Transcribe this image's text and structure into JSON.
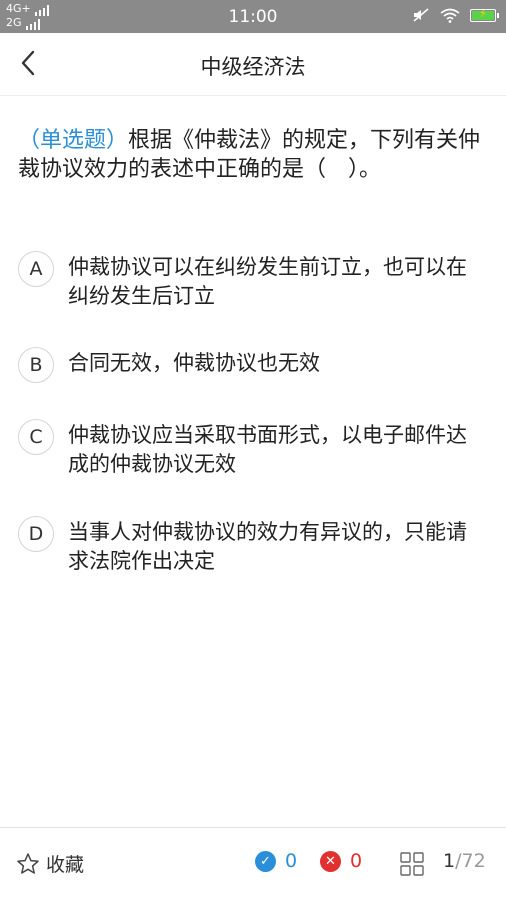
{
  "status_bar": {
    "network_primary": "4G+",
    "network_secondary": "2G",
    "time": "11:00"
  },
  "header": {
    "title": "中级经济法"
  },
  "question": {
    "type_label": "（单选题）",
    "text": "根据《仲裁法》的规定，下列有关仲裁协议效力的表述中正确的是（　）。",
    "options": [
      {
        "letter": "A",
        "text": "仲裁协议可以在纠纷发生前订立，也可以在纠纷发生后订立"
      },
      {
        "letter": "B",
        "text": "合同无效，仲裁协议也无效"
      },
      {
        "letter": "C",
        "text": "仲裁协议应当采取书面形式，以电子邮件达成的仲裁协议无效"
      },
      {
        "letter": "D",
        "text": "当事人对仲裁协议的效力有异议的，只能请求法院作出决定"
      }
    ]
  },
  "footer": {
    "favorite_label": "收藏",
    "correct_count": "0",
    "wrong_count": "0",
    "current_page": "1",
    "total_pages": "/72"
  },
  "colors": {
    "accent": "#2a8fd8",
    "correct": "#2a8fd8",
    "wrong": "#e0312e",
    "status_bar": "#8a8a8a"
  },
  "icons": {
    "back": "chevron-left-icon",
    "favorite": "star-outline-icon",
    "correct": "check-circle-icon",
    "wrong": "x-circle-icon",
    "grid": "grid-icon",
    "wifi": "wifi-icon",
    "battery": "battery-charging-icon",
    "mute": "mute-icon"
  }
}
